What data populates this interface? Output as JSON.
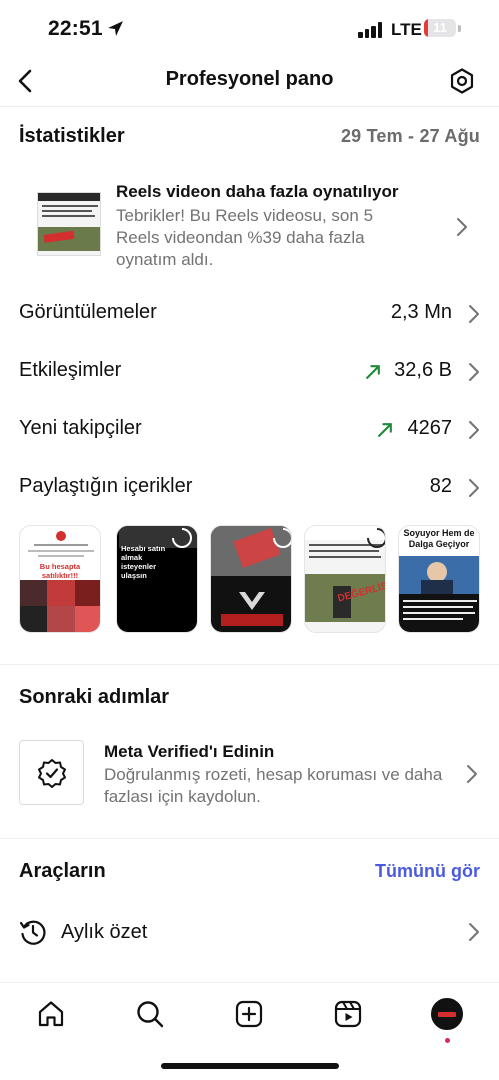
{
  "status_bar": {
    "time": "22:51",
    "network": "LTE",
    "battery": "11",
    "battery_level": 0.11
  },
  "header": {
    "title": "Profesyonel pano"
  },
  "statistics": {
    "title": "İstatistikler",
    "date_range": "29 Tem - 27 Ağu",
    "insight": {
      "title": "Reels videon daha fazla oynatılıyor",
      "description": "Tebrikler! Bu Reels videosu, son 5 Reels videondan %39 daha fazla oynatım aldı."
    },
    "rows": [
      {
        "label": "Görüntülemeler",
        "value": "2,3 Mn",
        "trend": ""
      },
      {
        "label": "Etkileşimler",
        "value": "32,6 B",
        "trend": "up"
      },
      {
        "label": "Yeni takipçiler",
        "value": "4267",
        "trend": "up"
      },
      {
        "label": "Paylaştığın içerikler",
        "value": "82",
        "trend": ""
      }
    ],
    "thumbnails": [
      {
        "caption": "Bu hesapta satılıktır!!!"
      },
      {
        "caption": "Hesabı satın almak isteyenler ulaşsın"
      },
      {
        "caption": ""
      },
      {
        "caption": "DEĞERLİSİZ"
      },
      {
        "caption": "Soyuyor Hem de Dalga Geçiyor"
      }
    ]
  },
  "next_steps": {
    "title": "Sonraki adımlar",
    "card": {
      "title": "Meta Verified'ı Edinin",
      "description": "Doğrulanmış rozeti, hesap koruması ve daha fazlası için kaydolun."
    }
  },
  "tools": {
    "title": "Araçların",
    "see_all": "Tümünü gör",
    "items": [
      {
        "label": "Aylık özet"
      }
    ]
  },
  "colors": {
    "accent": "#4a5be0",
    "trend_up": "#1f8a3a",
    "battery": "#e53935"
  }
}
